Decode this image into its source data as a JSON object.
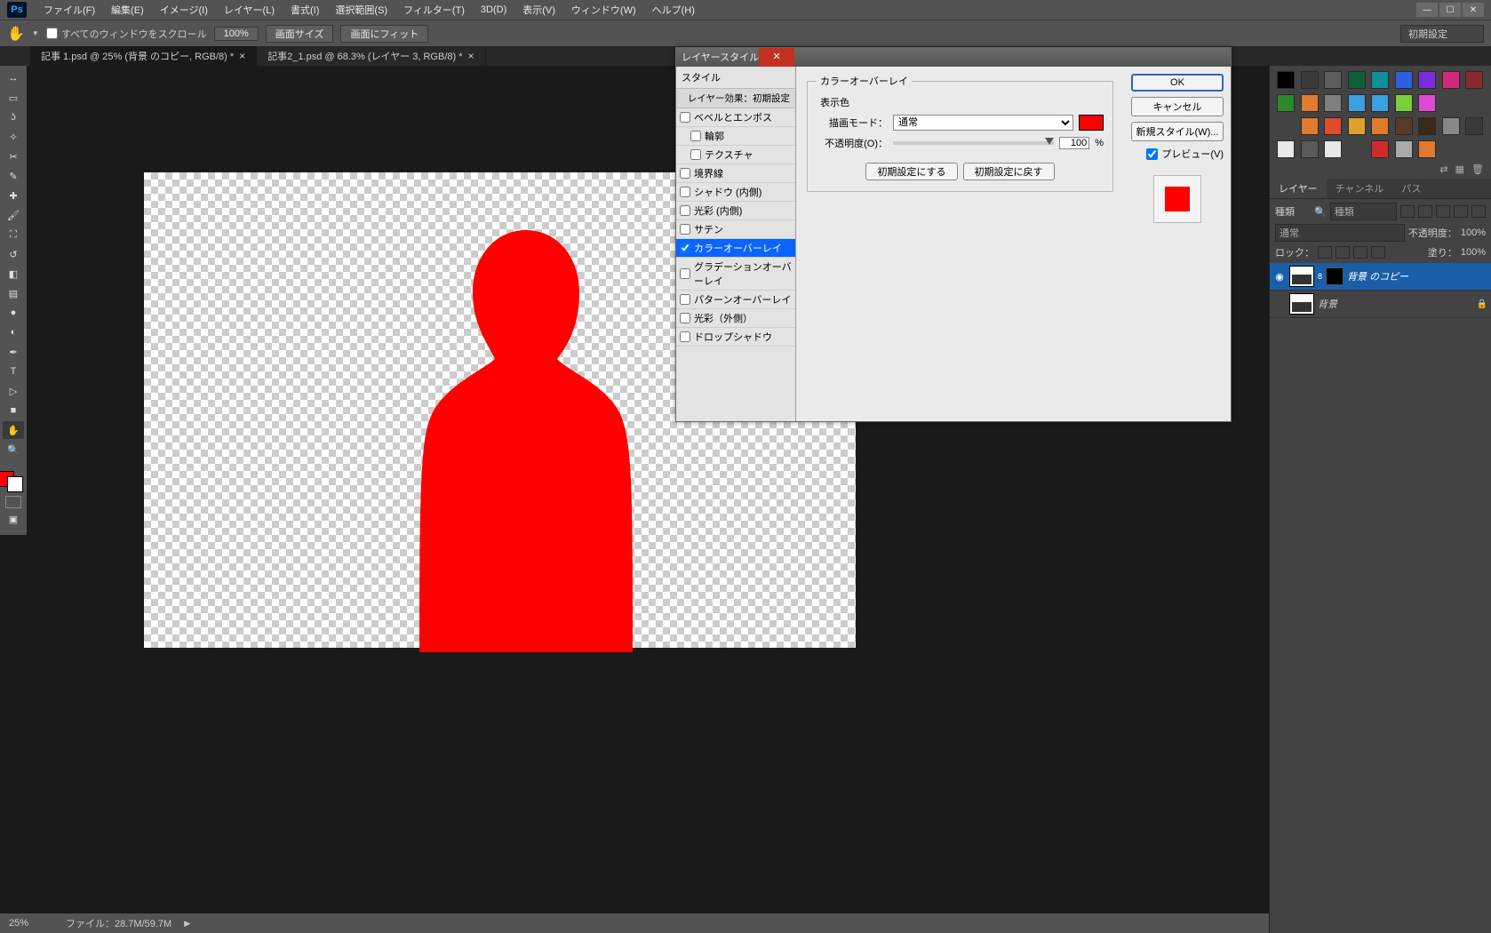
{
  "menubar": {
    "items": [
      "ファイル(F)",
      "編集(E)",
      "イメージ(I)",
      "レイヤー(L)",
      "書式(I)",
      "選択範囲(S)",
      "フィルター(T)",
      "3D(D)",
      "表示(V)",
      "ウィンドウ(W)",
      "ヘルプ(H)"
    ]
  },
  "optbar": {
    "scroll_all": "すべてのウィンドウをスクロール",
    "zoom": "100%",
    "actual": "画面サイズ",
    "fit": "画面にフィット",
    "preset": "初期設定"
  },
  "tabs": [
    {
      "label": "記事 1.psd @ 25% (背景 のコピー, RGB/8) *",
      "active": true
    },
    {
      "label": "記事2_1.psd @ 68.3% (レイヤー 3, RGB/8) *",
      "active": false
    }
  ],
  "status": {
    "zoom": "25%",
    "file": "ファイル：28.7M/59.7M"
  },
  "swatches": [
    "#000000",
    "#3a3a3a",
    "#5e5e5e",
    "#0f5f3a",
    "#0e8f9a",
    "#2d5fe0",
    "#7a2de0",
    "#d02b7a",
    "#8a2b2b",
    "#2b8a2b",
    "#e07a2d",
    "#808080",
    "#3aa0e0",
    "#39a0e0",
    "#78d03a",
    "#e04ad0",
    "",
    "",
    "",
    "#e07a2d",
    "#e04a2d",
    "#e0a02d",
    "#e07a2d",
    "#5a3a2a",
    "#3a2a1a",
    "#888",
    "#3a3a3a",
    "#e8e8e8",
    "#5a5a5a",
    "#e8e8e8",
    "",
    "#d02b2b",
    "#aaa",
    "#e07a2d",
    "",
    ""
  ],
  "layers_panel": {
    "tabs": [
      "レイヤー",
      "チャンネル",
      "パス"
    ],
    "kind": "種類",
    "blend": "通常",
    "opacity_label": "不透明度：",
    "opacity": "100%",
    "lock": "ロック：",
    "fill_label": "塗り：",
    "fill": "100%",
    "layers": [
      {
        "name": "背景 のコピー",
        "visible": true,
        "selected": true,
        "mask": true
      },
      {
        "name": "背景",
        "visible": false,
        "selected": false,
        "locked": true
      }
    ]
  },
  "dialog": {
    "title": "レイヤースタイル",
    "left_header": "スタイル",
    "left_sub": "レイヤー効果：初期設定",
    "effects": [
      {
        "label": "ベベルとエンボス",
        "checked": false,
        "indent": 0
      },
      {
        "label": "輪郭",
        "checked": false,
        "indent": 1
      },
      {
        "label": "テクスチャ",
        "checked": false,
        "indent": 1
      },
      {
        "label": "境界線",
        "checked": false,
        "indent": 0
      },
      {
        "label": "シャドウ (内側)",
        "checked": false,
        "indent": 0
      },
      {
        "label": "光彩 (内側)",
        "checked": false,
        "indent": 0
      },
      {
        "label": "サテン",
        "checked": false,
        "indent": 0
      },
      {
        "label": "カラーオーバーレイ",
        "checked": true,
        "indent": 0,
        "selected": true
      },
      {
        "label": "グラデーションオーバーレイ",
        "checked": false,
        "indent": 0
      },
      {
        "label": "パターンオーバーレイ",
        "checked": false,
        "indent": 0
      },
      {
        "label": "光彩（外側）",
        "checked": false,
        "indent": 0
      },
      {
        "label": "ドロップシャドウ",
        "checked": false,
        "indent": 0
      }
    ],
    "section_title": "カラーオーバーレイ",
    "subsection": "表示色",
    "blend_label": "描画モード：",
    "blend_value": "通常",
    "opacity_label": "不透明度(O)：",
    "opacity_value": "100",
    "pct": "%",
    "reset": "初期設定にする",
    "default": "初期設定に戻す",
    "ok": "OK",
    "cancel": "キャンセル",
    "newstyle": "新規スタイル(W)...",
    "preview": "プレビュー(V)",
    "overlay_color": "#ff0000"
  }
}
